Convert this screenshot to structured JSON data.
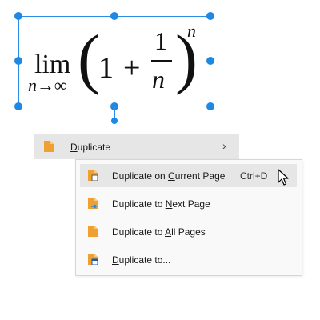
{
  "formula": {
    "lim": "lim",
    "subscript": "n→∞",
    "left_paren": "(",
    "one": "1",
    "plus": "+",
    "numerator": "1",
    "denominator": "n",
    "right_paren": ")",
    "exponent": "n"
  },
  "context_menu": {
    "duplicate_label": "Duplicate",
    "duplicate_accelerator": "D",
    "duplicate_rest": "uplicate",
    "chevron": "›",
    "icon": "document-icon"
  },
  "duplicate_submenu": {
    "items": [
      {
        "label_before": "Duplicate on ",
        "accelerator": "C",
        "label_after": "urrent Page",
        "shortcut": "Ctrl+D",
        "icon": "duplicate-current-page-icon",
        "hovered": true
      },
      {
        "label_before": "Duplicate to ",
        "accelerator": "N",
        "label_after": "ext Page",
        "shortcut": "",
        "icon": "duplicate-next-page-icon",
        "hovered": false
      },
      {
        "label_before": "Duplicate to ",
        "accelerator": "A",
        "label_after": "ll Pages",
        "shortcut": "",
        "icon": "duplicate-all-pages-icon",
        "hovered": false
      },
      {
        "label_before": "",
        "accelerator": "D",
        "label_after": "uplicate to...",
        "shortcut": "",
        "icon": "duplicate-to-window-icon",
        "hovered": false
      }
    ]
  },
  "colors": {
    "selection": "#1e88e5",
    "menu_bg": "#f9f9f9",
    "hover_bg": "#e6e6e6",
    "icon_orange": "#f0a030",
    "icon_blue": "#1e88e5"
  }
}
